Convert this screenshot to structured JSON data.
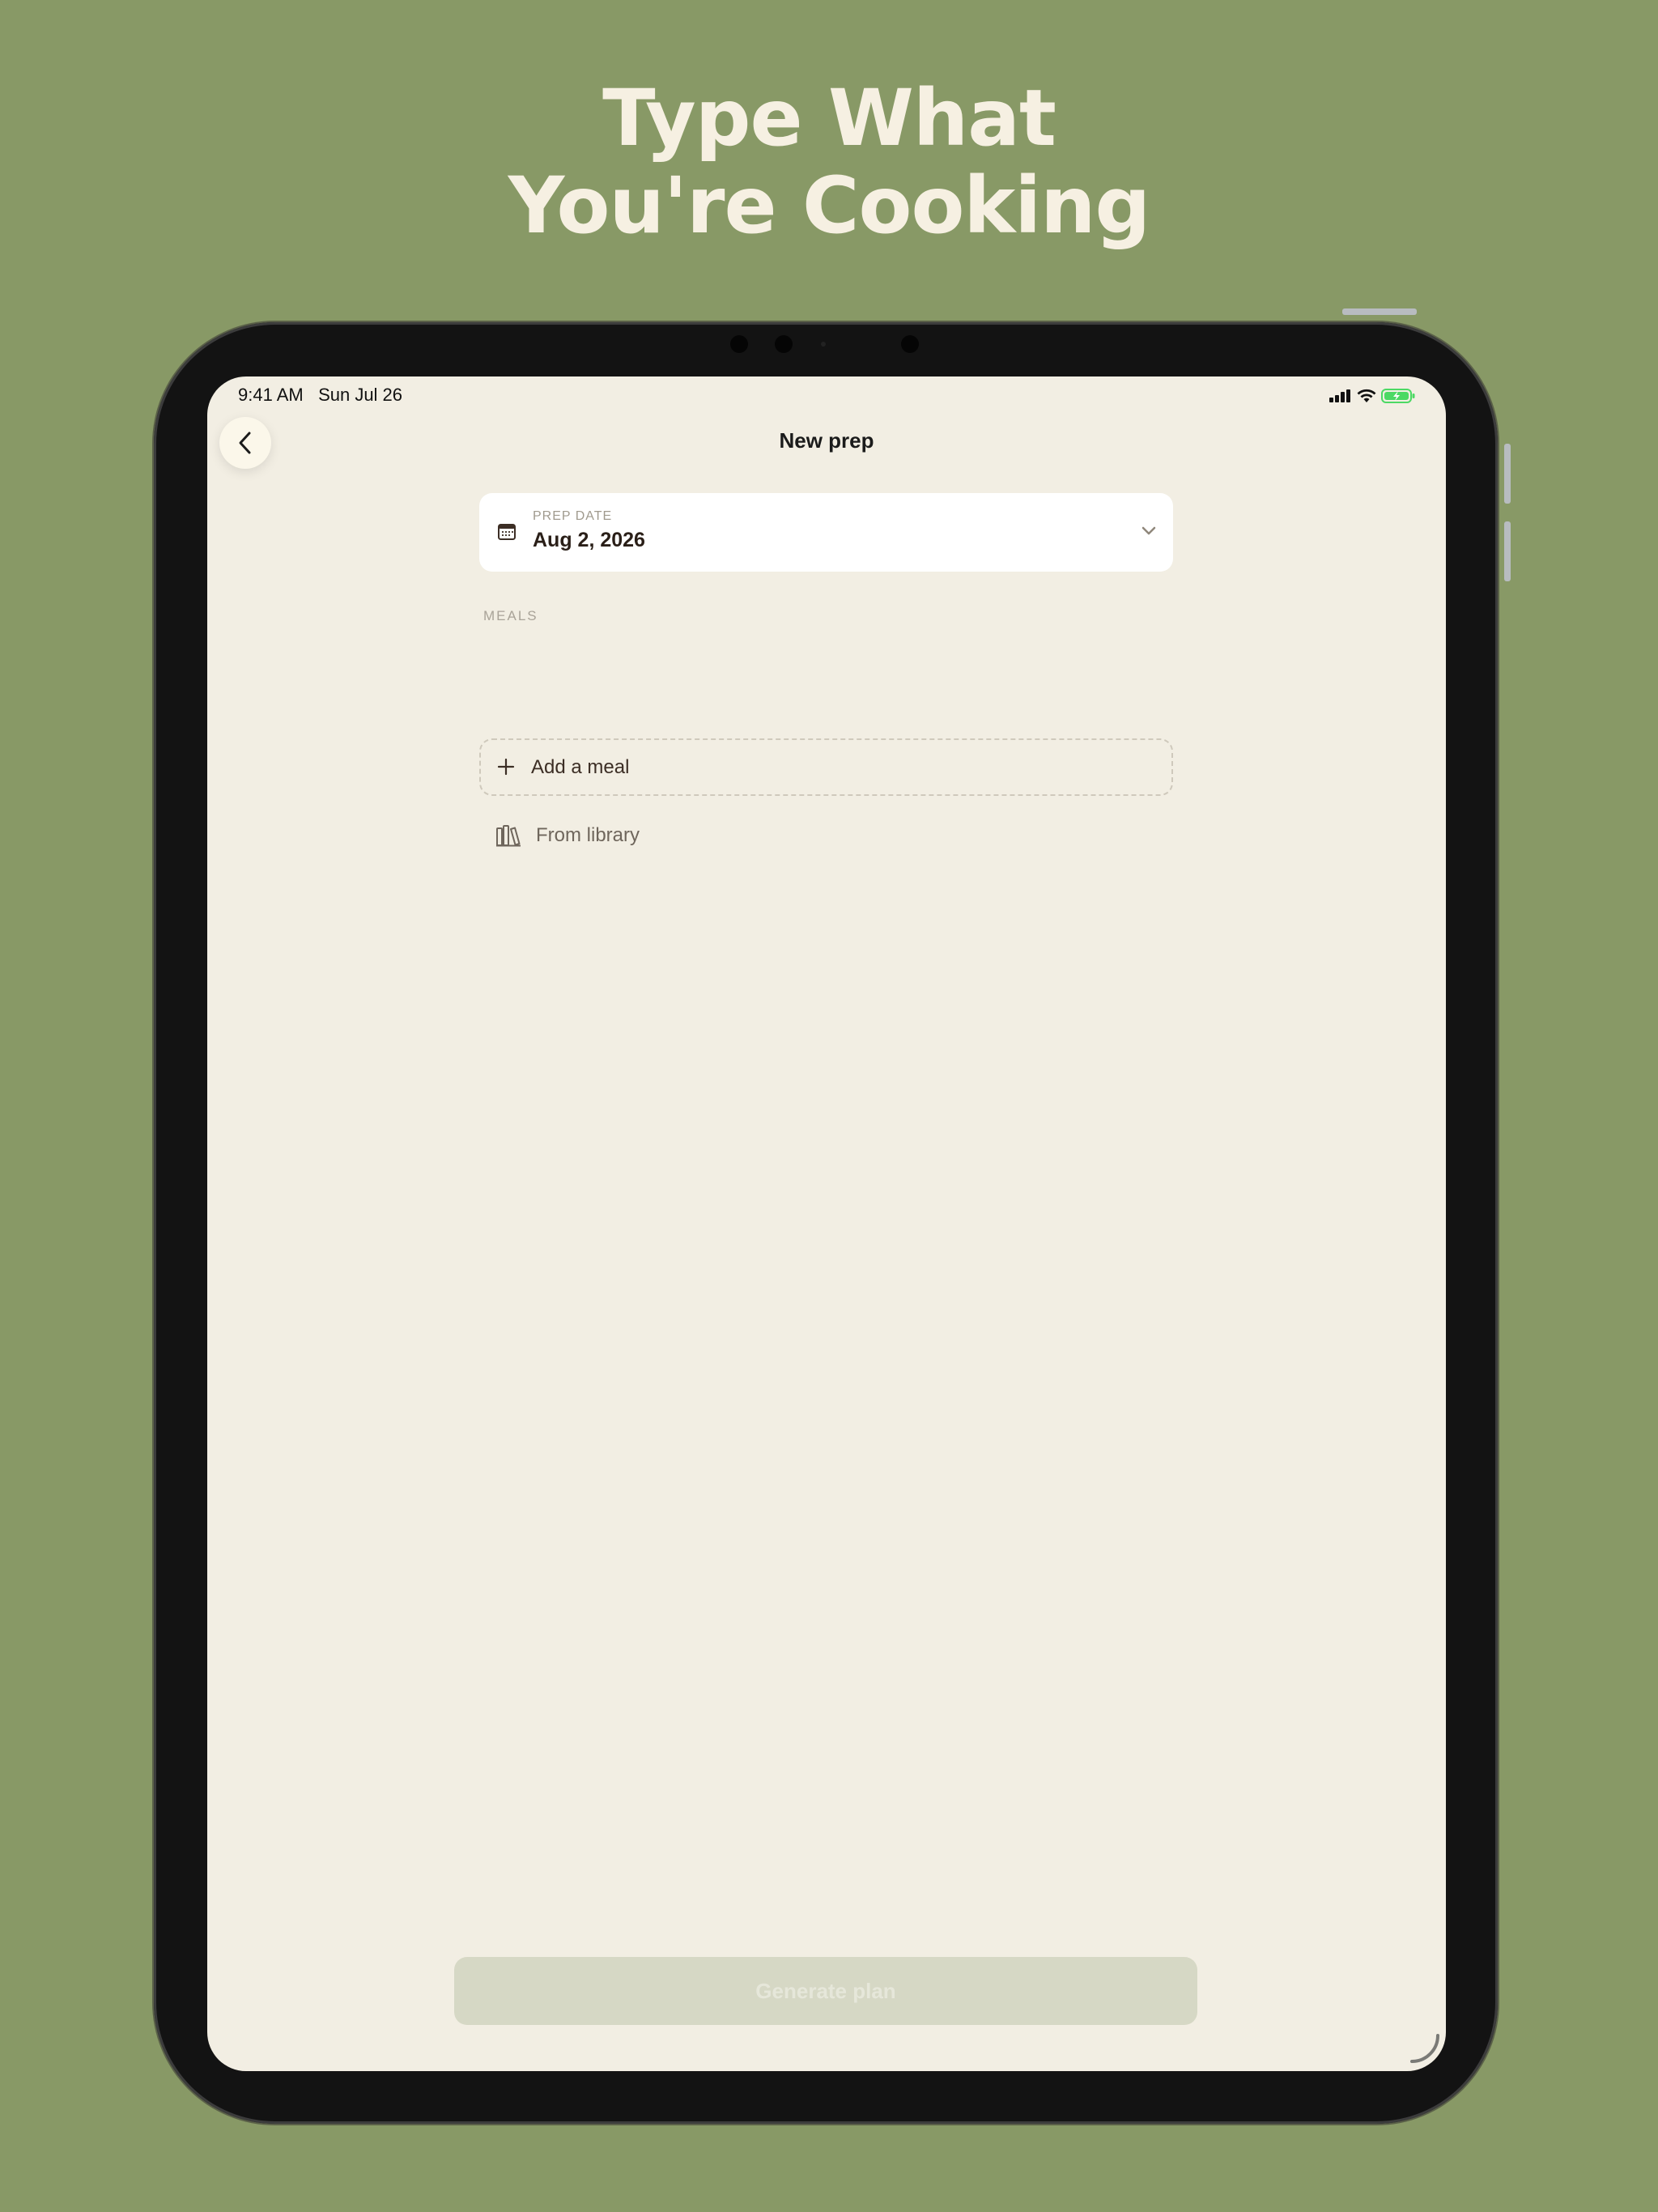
{
  "headline": {
    "line1": "Type What",
    "line2": "You're Cooking"
  },
  "status_bar": {
    "time": "9:41 AM",
    "date": "Sun Jul 26"
  },
  "nav": {
    "title": "New prep"
  },
  "prep_date": {
    "label": "PREP DATE",
    "value": "Aug 2, 2026"
  },
  "meals": {
    "section_label": "MEALS",
    "add_label": "Add a meal",
    "library_label": "From library"
  },
  "generate": {
    "label": "Generate plan"
  },
  "colors": {
    "background": "#889966",
    "headline": "#f6f0e2",
    "screen": "#f2eee3",
    "button_disabled": "#d6d8c5",
    "battery": "#4cd964"
  },
  "icons": [
    "back-chevron-icon",
    "calendar-icon",
    "chevron-down-icon",
    "plus-icon",
    "library-books-icon",
    "signal-icon",
    "wifi-icon",
    "battery-icon"
  ]
}
